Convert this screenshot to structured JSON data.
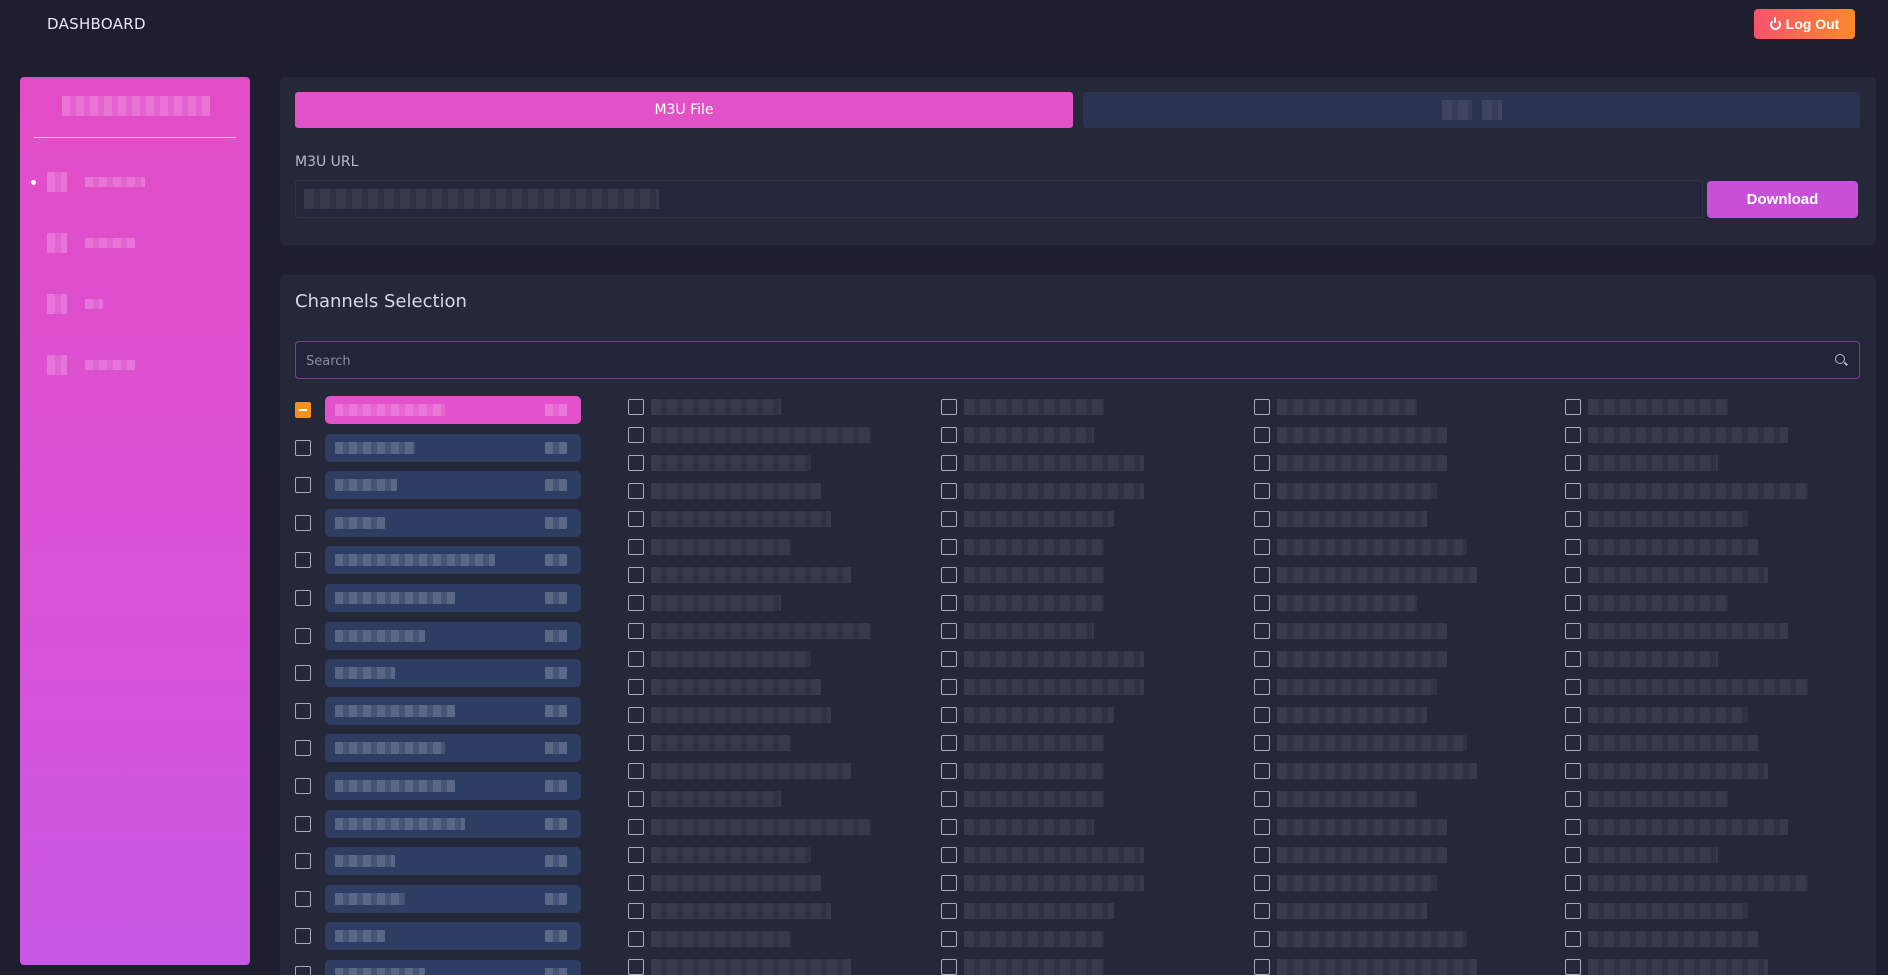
{
  "topbar": {
    "brand": "DASHBOARD",
    "logout_label": "Log Out"
  },
  "sidebar": {
    "items": 4,
    "active_index": 0
  },
  "source": {
    "tabs": [
      {
        "label": "M3U File",
        "active": true
      },
      {
        "label": "",
        "active": false
      }
    ],
    "url_label": "M3U URL",
    "url_value": "",
    "download_label": "Download"
  },
  "channels": {
    "title": "Channels Selection",
    "search_placeholder": "Search",
    "groups_visible": 16,
    "group_active_index": 0,
    "columns": 4,
    "rows_per_column": 21
  },
  "colors": {
    "accent": "#e052c6",
    "logout": "#f98a2a",
    "download": "#c84fd8",
    "checkbox_active": "#f5921e"
  }
}
